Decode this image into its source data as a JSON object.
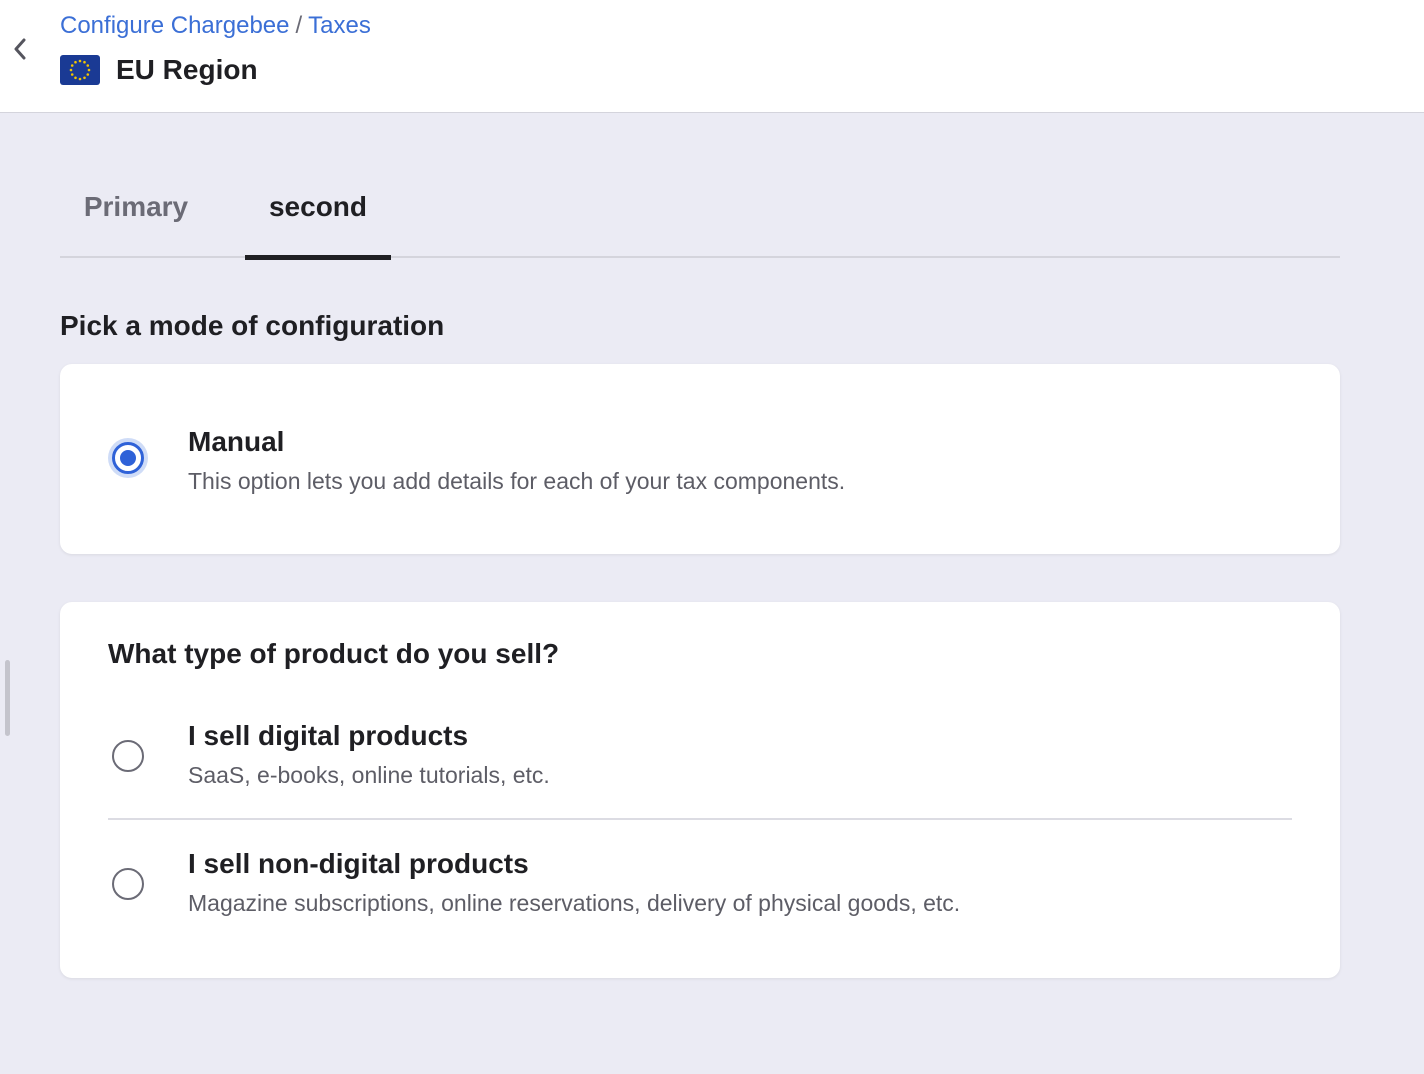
{
  "header": {
    "breadcrumb": [
      {
        "label": "Configure Chargebee"
      },
      {
        "label": "Taxes"
      }
    ],
    "breadcrumb_separator": "/",
    "title": "EU Region",
    "flag_icon": "eu-flag-icon",
    "back_icon": "chevron-left-icon"
  },
  "tabs": [
    {
      "label": "Primary",
      "active": false
    },
    {
      "label": "second",
      "active": true
    }
  ],
  "mode_section": {
    "heading": "Pick a mode of configuration",
    "options": [
      {
        "title": "Manual",
        "description": "This option lets you add details for each of your tax components.",
        "selected": true
      }
    ]
  },
  "product_section": {
    "question": "What type of product do you sell?",
    "options": [
      {
        "title": "I sell digital products",
        "description": "SaaS, e-books, online tutorials, etc.",
        "selected": false
      },
      {
        "title": "I sell non-digital products",
        "description": "Magazine subscriptions, online reservations, delivery of physical goods, etc.",
        "selected": false
      }
    ]
  },
  "colors": {
    "accent": "#2f62d8",
    "link": "#3b6fd6",
    "background": "#ebebf4",
    "flag_blue": "#1a3a94",
    "flag_star": "#f2c500"
  }
}
